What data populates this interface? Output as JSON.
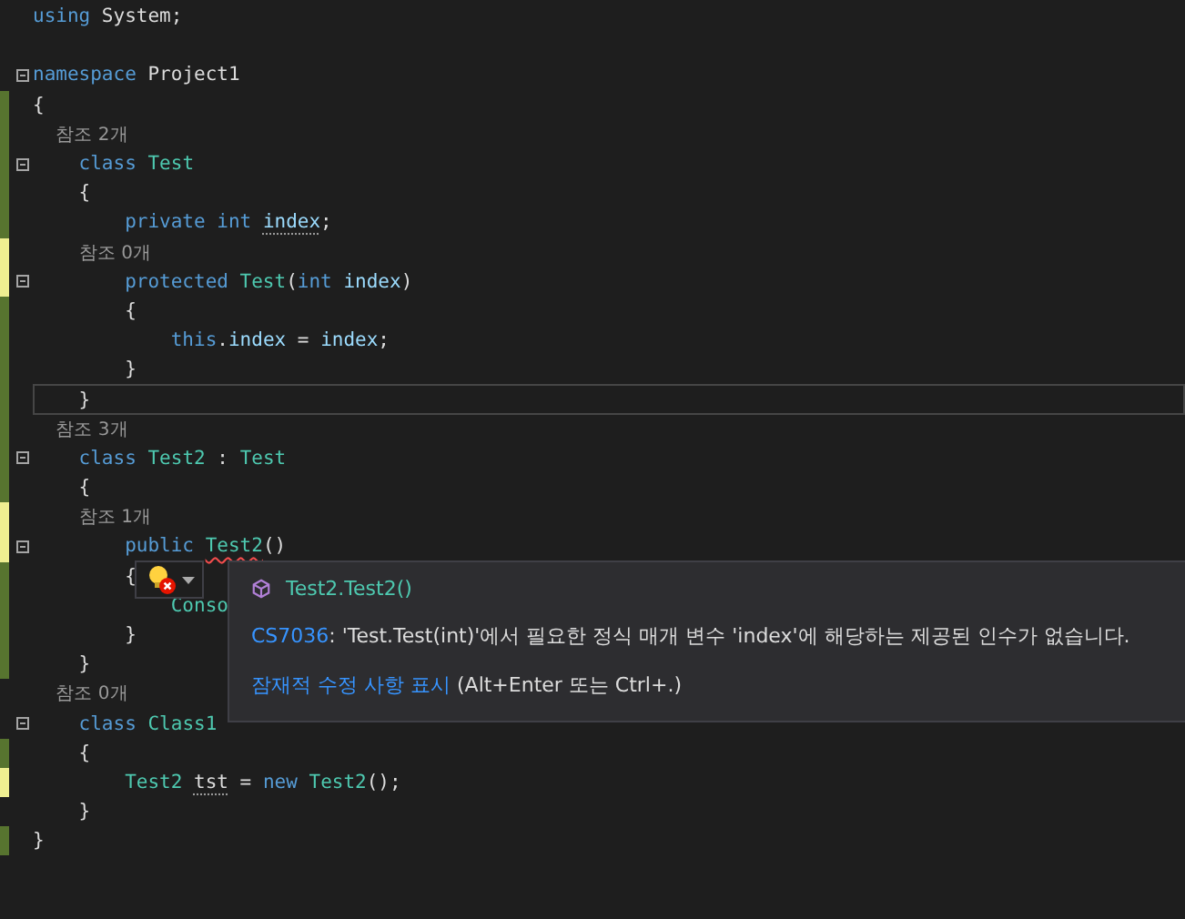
{
  "editor": {
    "lines": [
      {
        "kind": "code",
        "tokens": [
          {
            "text": "using",
            "kind": "keyword"
          },
          {
            "text": " System;",
            "kind": "plain"
          }
        ]
      },
      {
        "kind": "blank"
      },
      {
        "kind": "code",
        "fold": true,
        "tokens": [
          {
            "text": "namespace",
            "kind": "keyword"
          },
          {
            "text": " Project1",
            "kind": "plain"
          }
        ]
      },
      {
        "kind": "code",
        "color": "#57742f",
        "tokens": [
          {
            "text": "{",
            "kind": "plain"
          }
        ]
      },
      {
        "kind": "lens",
        "color": "#57742f",
        "text": "    참조 2개"
      },
      {
        "kind": "code",
        "color": "#57742f",
        "fold": true,
        "tokens": [
          {
            "text": "    class",
            "kind": "keyword"
          },
          {
            "text": " Test",
            "kind": "type"
          }
        ]
      },
      {
        "kind": "code",
        "color": "#57742f",
        "tokens": [
          {
            "text": "    {",
            "kind": "plain"
          }
        ]
      },
      {
        "kind": "code",
        "color": "#57742f",
        "tokens": [
          {
            "text": "        private int ",
            "kind": "keyword"
          },
          {
            "text": "index",
            "kind": "ident",
            "hint": true
          },
          {
            "text": ";",
            "kind": "plain"
          }
        ]
      },
      {
        "kind": "lens",
        "color": "#efef91",
        "text": "        참조 0개"
      },
      {
        "kind": "code",
        "color": "#efef91",
        "fold": true,
        "tokens": [
          {
            "text": "        protected",
            "kind": "keyword"
          },
          {
            "text": " Test",
            "kind": "type"
          },
          {
            "text": "(",
            "kind": "plain"
          },
          {
            "text": "int",
            "kind": "keyword"
          },
          {
            "text": " index",
            "kind": "ident"
          },
          {
            "text": ")",
            "kind": "plain"
          }
        ]
      },
      {
        "kind": "code",
        "color": "#57742f",
        "tokens": [
          {
            "text": "        {",
            "kind": "plain"
          }
        ]
      },
      {
        "kind": "code",
        "color": "#57742f",
        "tokens": [
          {
            "text": "            this",
            "kind": "keyword"
          },
          {
            "text": ".",
            "kind": "plain"
          },
          {
            "text": "index",
            "kind": "ident"
          },
          {
            "text": " = ",
            "kind": "plain"
          },
          {
            "text": "index",
            "kind": "ident"
          },
          {
            "text": ";",
            "kind": "plain"
          }
        ]
      },
      {
        "kind": "code",
        "color": "#57742f",
        "tokens": [
          {
            "text": "        }",
            "kind": "plain"
          }
        ]
      },
      {
        "kind": "code",
        "color": "#57742f",
        "current": true,
        "tokens": [
          {
            "text": "    }",
            "kind": "plain"
          }
        ]
      },
      {
        "kind": "lens",
        "color": "#57742f",
        "text": "    참조 3개"
      },
      {
        "kind": "code",
        "color": "#57742f",
        "fold": true,
        "tokens": [
          {
            "text": "    class",
            "kind": "keyword"
          },
          {
            "text": " Test2",
            "kind": "type"
          },
          {
            "text": " : ",
            "kind": "plain"
          },
          {
            "text": "Test",
            "kind": "type"
          }
        ]
      },
      {
        "kind": "code",
        "color": "#57742f",
        "tokens": [
          {
            "text": "    {",
            "kind": "plain"
          }
        ]
      },
      {
        "kind": "lens",
        "color": "#efef91",
        "text": "        참조 1개"
      },
      {
        "kind": "code",
        "color": "#efef91",
        "fold": true,
        "tokens": [
          {
            "text": "        public ",
            "kind": "keyword"
          },
          {
            "text": "Test2",
            "kind": "type",
            "error": true
          },
          {
            "text": "()",
            "kind": "plain"
          }
        ]
      },
      {
        "kind": "code",
        "color": "#57742f",
        "tokens": [
          {
            "text": "        {",
            "kind": "plain"
          }
        ]
      },
      {
        "kind": "code",
        "color": "#57742f",
        "tokens": [
          {
            "text": "            Conso",
            "kind": "type"
          }
        ]
      },
      {
        "kind": "code",
        "color": "#57742f",
        "tokens": [
          {
            "text": "        }",
            "kind": "plain"
          }
        ]
      },
      {
        "kind": "code",
        "color": "#57742f",
        "tokens": [
          {
            "text": "    }",
            "kind": "plain"
          }
        ]
      },
      {
        "kind": "lens",
        "text": "    참조 0개"
      },
      {
        "kind": "code",
        "fold": true,
        "tokens": [
          {
            "text": "    class",
            "kind": "keyword"
          },
          {
            "text": " Class1",
            "kind": "type"
          }
        ]
      },
      {
        "kind": "code",
        "color": "#57742f",
        "tokens": [
          {
            "text": "    {",
            "kind": "plain"
          }
        ]
      },
      {
        "kind": "code",
        "color": "#efef91",
        "tokens": [
          {
            "text": "        Test2 ",
            "kind": "type"
          },
          {
            "text": "tst",
            "kind": "plain",
            "hint": true
          },
          {
            "text": " = ",
            "kind": "plain"
          },
          {
            "text": "new",
            "kind": "keyword"
          },
          {
            "text": " Test2",
            "kind": "type"
          },
          {
            "text": "();",
            "kind": "plain"
          }
        ]
      },
      {
        "kind": "code",
        "tokens": [
          {
            "text": "    }",
            "kind": "plain"
          }
        ]
      },
      {
        "kind": "code",
        "color": "#57742f",
        "tokens": [
          {
            "text": "}",
            "kind": "plain"
          }
        ]
      }
    ]
  },
  "quick_info": {
    "symbol": "Test2.Test2()",
    "error_code": "CS7036",
    "message": ": 'Test.Test(int)'에서 필요한 정식 매개 변수 'index'에 해당하는 제공된 인수가 없습니다.",
    "action_link": "잠재적 수정 사항 표시",
    "shortcut": "(Alt+Enter 또는 Ctrl+.)"
  }
}
